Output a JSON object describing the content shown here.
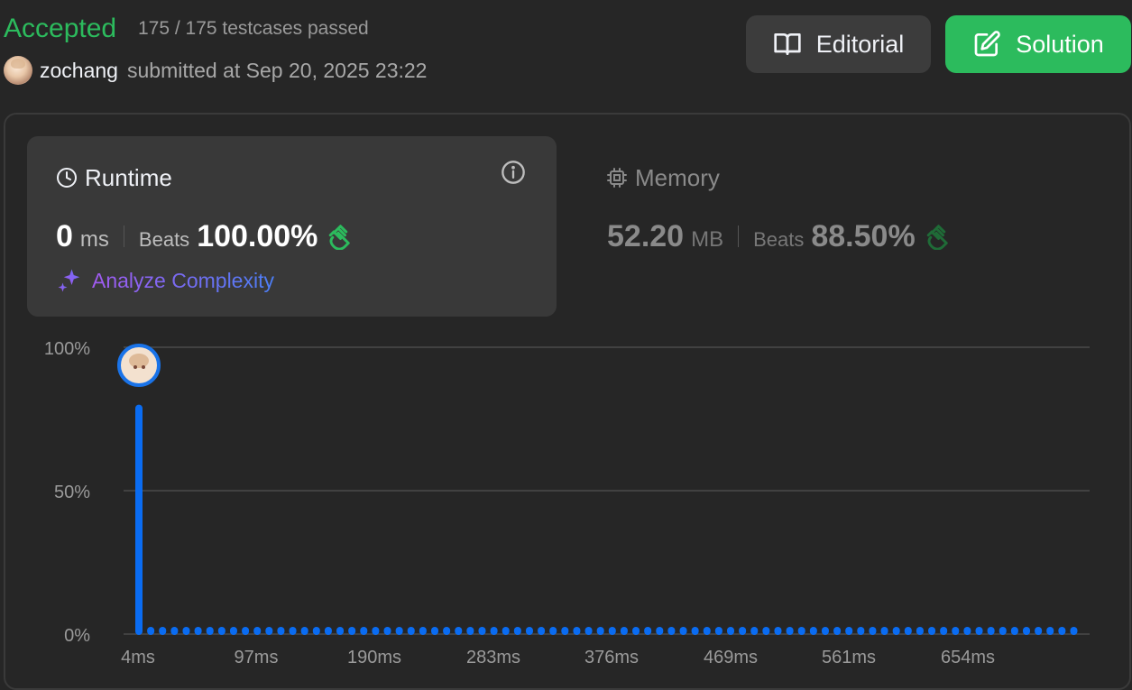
{
  "header": {
    "status": "Accepted",
    "testcases_passed": "175 / 175 testcases passed",
    "username": "zochang",
    "submitted_text": "submitted at Sep 20, 2025 23:22",
    "editorial_label": "Editorial",
    "solution_label": "Solution"
  },
  "runtime": {
    "title": "Runtime",
    "value": "0",
    "unit": "ms",
    "beats_label": "Beats",
    "beats_value": "100.00%",
    "analyze_label": "Analyze Complexity"
  },
  "memory": {
    "title": "Memory",
    "value": "52.20",
    "unit": "MB",
    "beats_label": "Beats",
    "beats_value": "88.50%"
  },
  "colors": {
    "accepted": "#2cbb5d",
    "bar": "#0a6cf2",
    "solution_button": "#2cbb5d"
  },
  "chart_data": {
    "type": "bar",
    "ylim": [
      0,
      100
    ],
    "y_ticks": [
      "100%",
      "50%",
      "0%"
    ],
    "x_tick_labels": [
      "4ms",
      "97ms",
      "190ms",
      "283ms",
      "376ms",
      "469ms",
      "561ms",
      "654ms"
    ],
    "x_range_ms": [
      4,
      754
    ],
    "bar_count": 80,
    "first_bar_value": 80,
    "other_bars_value": 0.5,
    "marker": "current submission at 4ms"
  }
}
